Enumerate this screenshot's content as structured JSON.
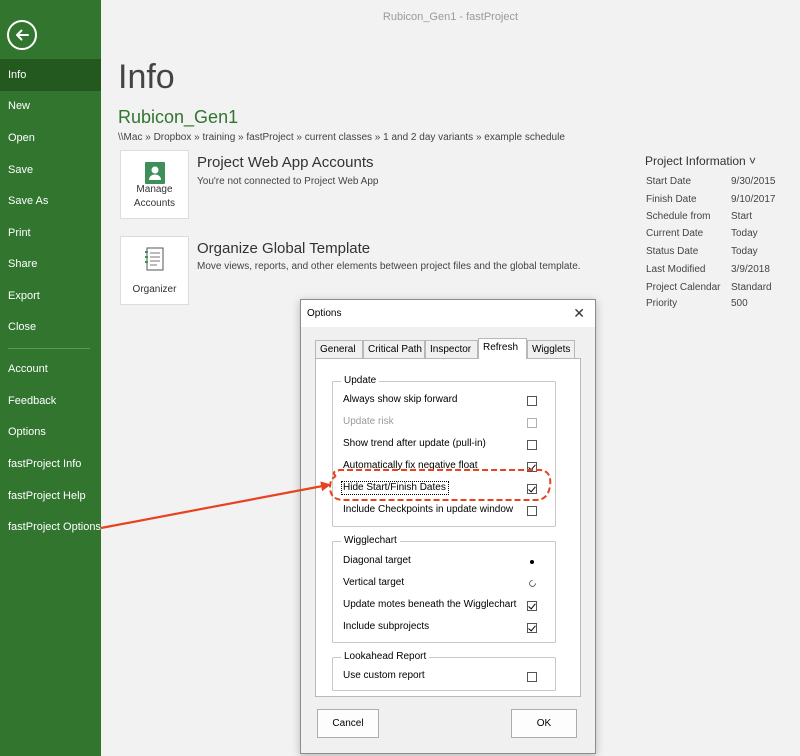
{
  "window_title": "Rubicon_Gen1  -  fastProject",
  "sidebar": {
    "items": [
      {
        "label": "Info",
        "active": true
      },
      {
        "label": "New"
      },
      {
        "label": "Open"
      },
      {
        "label": "Save"
      },
      {
        "label": "Save As"
      },
      {
        "label": "Print"
      },
      {
        "label": "Share"
      },
      {
        "label": "Export"
      },
      {
        "label": "Close"
      },
      {
        "label": "Account"
      },
      {
        "label": "Feedback"
      },
      {
        "label": "Options"
      },
      {
        "label": "fastProject Info"
      },
      {
        "label": "fastProject Help"
      },
      {
        "label": "fastProject Options"
      }
    ]
  },
  "main": {
    "title": "Info",
    "project_name": "Rubicon_Gen1",
    "breadcrumb": "\\\\Mac » Dropbox » training » fastProject » current classes » 1 and 2 day variants » example schedule",
    "accounts": {
      "tile_label_1": "Manage",
      "tile_label_2": "Accounts",
      "heading": "Project Web App Accounts",
      "sub": "You're not connected to Project Web App"
    },
    "organizer": {
      "tile_label": "Organizer",
      "heading": "Organize Global Template",
      "sub": "Move views, reports, and other elements between project files and the global template."
    }
  },
  "project_info": {
    "title": "Project Information ˅",
    "rows": [
      {
        "label": "Start Date",
        "value": "9/30/2015"
      },
      {
        "label": "Finish Date",
        "value": "9/10/2017"
      },
      {
        "label": "Schedule from",
        "value": "Start"
      },
      {
        "label": "Current Date",
        "value": "Today"
      },
      {
        "label": "Status Date",
        "value": "Today"
      },
      {
        "label": "Last Modified",
        "value": "3/9/2018"
      },
      {
        "label": "Project Calendar",
        "value": "Standard"
      },
      {
        "label": "Priority",
        "value": "500"
      }
    ]
  },
  "dialog": {
    "title": "Options",
    "close": "✕",
    "tabs": [
      {
        "label": "General"
      },
      {
        "label": "Critical Path"
      },
      {
        "label": "Inspector"
      },
      {
        "label": "Refresh",
        "active": true
      },
      {
        "label": "Wigglets"
      }
    ],
    "update_group": {
      "label": "Update",
      "options": [
        {
          "label": "Always show skip forward",
          "checked": false,
          "enabled": true
        },
        {
          "label": "Update risk",
          "checked": false,
          "enabled": false
        },
        {
          "label": "Show trend after update (pull-in)",
          "checked": false,
          "enabled": true
        },
        {
          "label": "Automatically fix negative float",
          "checked": true,
          "enabled": true
        },
        {
          "label": "Hide Start/Finish Dates",
          "checked": true,
          "enabled": true
        },
        {
          "label": "Include Checkpoints in update window",
          "checked": false,
          "enabled": true
        }
      ]
    },
    "wigglechart_group": {
      "label": "Wigglechart",
      "options": [
        {
          "label": "Diagonal target",
          "type": "radio",
          "checked": true
        },
        {
          "label": "Vertical target",
          "type": "radio",
          "checked": false
        },
        {
          "label": "Update motes beneath the Wigglechart",
          "type": "checkbox",
          "checked": true
        },
        {
          "label": "Include subprojects",
          "type": "checkbox",
          "checked": true
        }
      ]
    },
    "lookahead_group": {
      "label": "Lookahead Report",
      "options": [
        {
          "label": "Use custom report",
          "checked": false
        }
      ]
    },
    "cancel_label": "Cancel",
    "ok_label": "OK"
  },
  "colors": {
    "sidebar": "#31752f",
    "sidebar_active": "#23591f",
    "accent_text": "#31752f",
    "annotation": "#e8421f"
  }
}
